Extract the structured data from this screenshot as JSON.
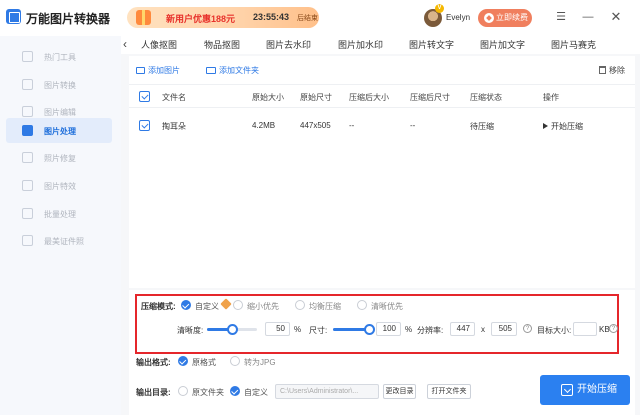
{
  "app": {
    "title": "万能图片转换器"
  },
  "promo": {
    "text": "新用户优惠188元",
    "timer": "23:55:43",
    "suffix": "后结束"
  },
  "user": {
    "vip_badge": "V",
    "name": "Evelyn",
    "renew_label": "立即续费"
  },
  "sidebar": {
    "items": [
      {
        "label": "热门工具",
        "active": false
      },
      {
        "label": "图片转换",
        "active": false
      },
      {
        "label": "图片编辑",
        "active": false
      },
      {
        "label": "图片处理",
        "active": true
      },
      {
        "label": "照片修复",
        "active": false
      },
      {
        "label": "图片特效",
        "active": false
      },
      {
        "label": "批量处理",
        "active": false
      },
      {
        "label": "最美证件照",
        "active": false
      }
    ]
  },
  "tabs": [
    "人像抠图",
    "物品抠图",
    "图片去水印",
    "图片加水印",
    "图片转文字",
    "图片加文字",
    "图片马赛克"
  ],
  "toolbar": {
    "add_picture": "添加图片",
    "add_folder": "添加文件夹",
    "remove": "移除"
  },
  "table": {
    "headers": [
      "文件名",
      "原始大小",
      "原始尺寸",
      "压缩后大小",
      "压缩后尺寸",
      "压缩状态",
      "操作"
    ],
    "rows": [
      {
        "name": "掏耳朵",
        "size": "4.2MB",
        "dims": "447x505",
        "new_size": "--",
        "new_dims": "--",
        "status": "待压缩",
        "action": "开始压缩"
      }
    ]
  },
  "compress": {
    "mode_label": "压缩模式:",
    "modes": [
      "自定义",
      "缩小优先",
      "均衡压缩",
      "清晰优先"
    ],
    "selected_mode": "自定义",
    "clarity_label": "清晰度:",
    "clarity_value": "50",
    "clarity_percent": 50,
    "size_label": "尺寸:",
    "size_value": "100",
    "size_percent": 100,
    "percent_unit": "%",
    "resolution_label": "分辨率:",
    "res_width": "447",
    "res_x": "x",
    "res_height": "505",
    "target_label": "目标大小:",
    "target_value": "",
    "target_unit": "KB"
  },
  "output_format": {
    "label": "输出格式:",
    "options": [
      "原格式",
      "转为JPG"
    ],
    "selected": "原格式"
  },
  "output_dir": {
    "label": "输出目录:",
    "options": [
      "原文件夹",
      "自定义"
    ],
    "selected": "自定义",
    "path": "C:\\Users\\Administrator\\...",
    "change_button": "更改目录",
    "open_button": "打开文件夹"
  },
  "start_button": "开始压缩",
  "colors": {
    "accent": "#2f7ae5",
    "highlight_border": "#e5262b",
    "promo_red": "#e8322c",
    "renew": "#f07f5e"
  }
}
